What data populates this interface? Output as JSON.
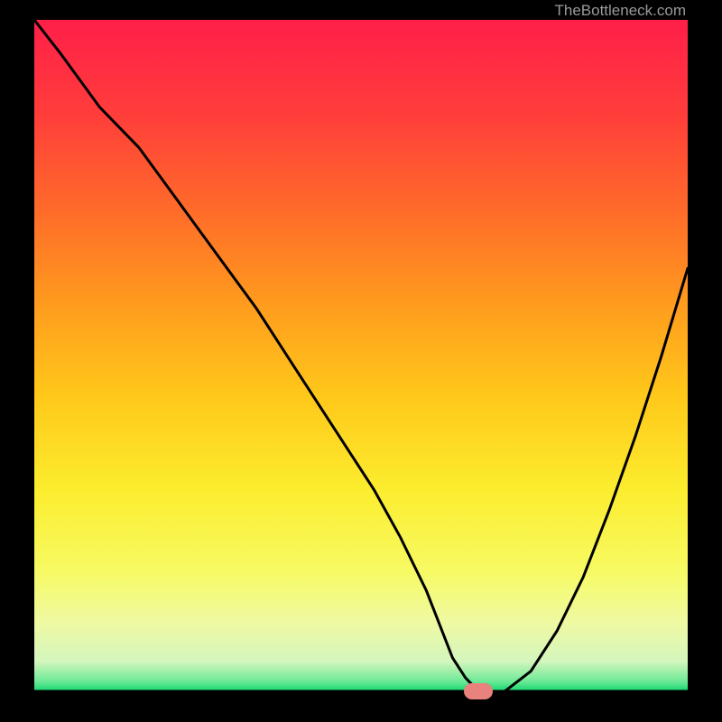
{
  "credit": "TheBottleneck.com",
  "chart_data": {
    "type": "line",
    "title": "",
    "xlabel": "",
    "ylabel": "",
    "xlim": [
      0,
      100
    ],
    "ylim": [
      0,
      100
    ],
    "series": [
      {
        "name": "bottleneck-curve",
        "x": [
          0,
          4,
          10,
          16,
          22,
          28,
          34,
          40,
          46,
          52,
          56,
          60,
          62,
          64,
          66,
          68,
          70,
          72,
          76,
          80,
          84,
          88,
          92,
          96,
          100
        ],
        "y": [
          100,
          95,
          87,
          81,
          73,
          65,
          57,
          48,
          39,
          30,
          23,
          15,
          10,
          5,
          2,
          0,
          0,
          0,
          3,
          9,
          17,
          27,
          38,
          50,
          63
        ]
      }
    ],
    "baseline_y": 0,
    "marker": {
      "x": 68,
      "y": 0,
      "color": "#e9817d"
    },
    "gradient_stops": [
      {
        "offset": 0.0,
        "color": "#ff1f49"
      },
      {
        "offset": 0.14,
        "color": "#ff3d3b"
      },
      {
        "offset": 0.28,
        "color": "#ff6a2a"
      },
      {
        "offset": 0.42,
        "color": "#ff9a1e"
      },
      {
        "offset": 0.56,
        "color": "#ffc81a"
      },
      {
        "offset": 0.7,
        "color": "#fced2e"
      },
      {
        "offset": 0.82,
        "color": "#f7fa63"
      },
      {
        "offset": 0.9,
        "color": "#eef9a4"
      },
      {
        "offset": 0.955,
        "color": "#d4f6bd"
      },
      {
        "offset": 0.985,
        "color": "#6ee997"
      },
      {
        "offset": 1.0,
        "color": "#12d66f"
      }
    ]
  }
}
